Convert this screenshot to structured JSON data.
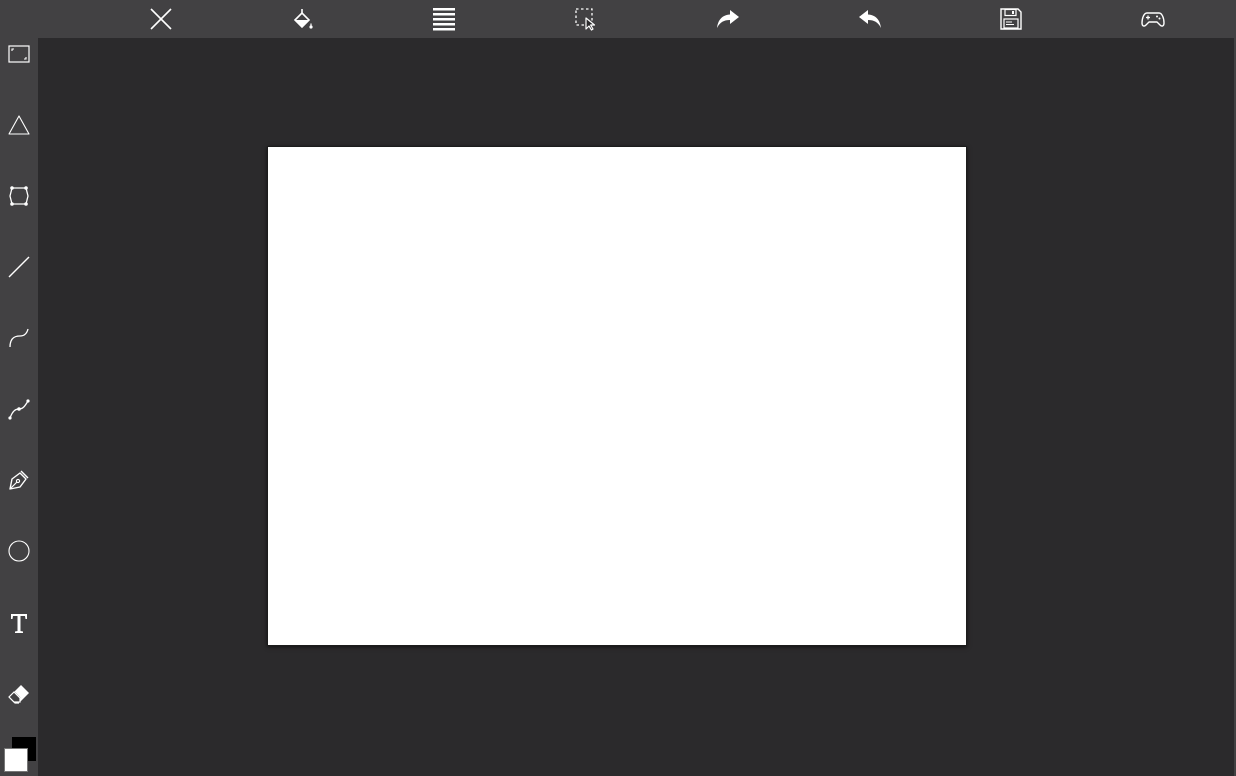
{
  "app": {
    "background": "#2b2a2c",
    "toolbar_background": "#424143",
    "icon_color": "#ffffff"
  },
  "top_toolbar": {
    "buttons": [
      {
        "icon": "close-icon"
      },
      {
        "icon": "paint-bucket-icon"
      },
      {
        "icon": "menu-lines-icon"
      },
      {
        "icon": "select-region-icon"
      },
      {
        "icon": "redo-icon"
      },
      {
        "icon": "undo-icon"
      },
      {
        "icon": "save-icon"
      },
      {
        "icon": "gamepad-icon"
      }
    ]
  },
  "tools": [
    {
      "icon": "image-frame-icon"
    },
    {
      "icon": "triangle-icon"
    },
    {
      "icon": "polygon-shape-icon"
    },
    {
      "icon": "line-icon"
    },
    {
      "icon": "curve-icon"
    },
    {
      "icon": "bezier-icon"
    },
    {
      "icon": "pen-nib-icon"
    },
    {
      "icon": "circle-icon"
    },
    {
      "icon": "text-icon"
    },
    {
      "icon": "eraser-icon"
    }
  ],
  "colors": {
    "primary": "#000000",
    "secondary": "#ffffff"
  },
  "canvas": {
    "background": "#ffffff"
  }
}
